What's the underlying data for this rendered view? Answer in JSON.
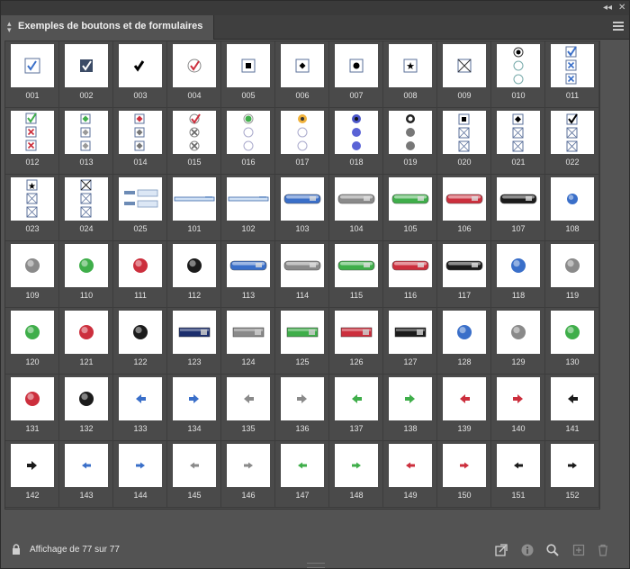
{
  "panel": {
    "title": "Exemples de boutons et de formulaires",
    "status": "Affichage de 77 sur 77"
  },
  "items": [
    {
      "label": "001",
      "kind": "check-box"
    },
    {
      "label": "002",
      "kind": "check-dark"
    },
    {
      "label": "003",
      "kind": "check-plain"
    },
    {
      "label": "004",
      "kind": "check-red-circle"
    },
    {
      "label": "005",
      "kind": "square-box"
    },
    {
      "label": "006",
      "kind": "diamond-box"
    },
    {
      "label": "007",
      "kind": "circle-box"
    },
    {
      "label": "008",
      "kind": "star-box"
    },
    {
      "label": "009",
      "kind": "cross-box"
    },
    {
      "label": "010",
      "kind": "radio-stack"
    },
    {
      "label": "011",
      "kind": "check-x-stack"
    },
    {
      "label": "012",
      "kind": "check-x-stack-red"
    },
    {
      "label": "013",
      "kind": "diamond-stack-green"
    },
    {
      "label": "014",
      "kind": "diamond-stack-red"
    },
    {
      "label": "015",
      "kind": "check-circle-stack"
    },
    {
      "label": "016",
      "kind": "radio-green-stack"
    },
    {
      "label": "017",
      "kind": "radio-orange-stack"
    },
    {
      "label": "018",
      "kind": "radio-blue-stack"
    },
    {
      "label": "019",
      "kind": "radio-gray-stack"
    },
    {
      "label": "020",
      "kind": "square-stack"
    },
    {
      "label": "021",
      "kind": "diamond-stack"
    },
    {
      "label": "022",
      "kind": "check-stack"
    },
    {
      "label": "023",
      "kind": "star-stack"
    },
    {
      "label": "024",
      "kind": "cross-stack"
    },
    {
      "label": "025",
      "kind": "fields"
    },
    {
      "label": "101",
      "kind": "bar-thin"
    },
    {
      "label": "102",
      "kind": "bar-thin"
    },
    {
      "label": "103",
      "kind": "pill-blue"
    },
    {
      "label": "104",
      "kind": "pill-gray"
    },
    {
      "label": "105",
      "kind": "pill-green"
    },
    {
      "label": "106",
      "kind": "pill-red"
    },
    {
      "label": "107",
      "kind": "pill-black"
    },
    {
      "label": "108",
      "kind": "ball-blue-sm"
    },
    {
      "label": "109",
      "kind": "ball-gray"
    },
    {
      "label": "110",
      "kind": "ball-green"
    },
    {
      "label": "111",
      "kind": "ball-red"
    },
    {
      "label": "112",
      "kind": "ball-black"
    },
    {
      "label": "113",
      "kind": "pill-blue"
    },
    {
      "label": "114",
      "kind": "pill-gray"
    },
    {
      "label": "115",
      "kind": "pill-green"
    },
    {
      "label": "116",
      "kind": "pill-red"
    },
    {
      "label": "117",
      "kind": "pill-black"
    },
    {
      "label": "118",
      "kind": "ball-blue"
    },
    {
      "label": "119",
      "kind": "ball-gray"
    },
    {
      "label": "120",
      "kind": "ball-green"
    },
    {
      "label": "121",
      "kind": "ball-red"
    },
    {
      "label": "122",
      "kind": "ball-black"
    },
    {
      "label": "123",
      "kind": "rect-navy"
    },
    {
      "label": "124",
      "kind": "rect-gray"
    },
    {
      "label": "125",
      "kind": "rect-green"
    },
    {
      "label": "126",
      "kind": "rect-red"
    },
    {
      "label": "127",
      "kind": "rect-black"
    },
    {
      "label": "128",
      "kind": "ball-blue"
    },
    {
      "label": "129",
      "kind": "ball-gray"
    },
    {
      "label": "130",
      "kind": "ball-green"
    },
    {
      "label": "131",
      "kind": "ball-red"
    },
    {
      "label": "132",
      "kind": "ball-black"
    },
    {
      "label": "133",
      "kind": "arrow-left-blue"
    },
    {
      "label": "134",
      "kind": "arrow-right-blue"
    },
    {
      "label": "135",
      "kind": "arrow-left-gray"
    },
    {
      "label": "136",
      "kind": "arrow-right-gray"
    },
    {
      "label": "137",
      "kind": "arrow-left-green"
    },
    {
      "label": "138",
      "kind": "arrow-right-green"
    },
    {
      "label": "139",
      "kind": "arrow-left-red"
    },
    {
      "label": "140",
      "kind": "arrow-right-red"
    },
    {
      "label": "141",
      "kind": "arrow-left-black"
    },
    {
      "label": "142",
      "kind": "arrow-right-black"
    },
    {
      "label": "143",
      "kind": "chevron-left-blue"
    },
    {
      "label": "144",
      "kind": "chevron-right-blue"
    },
    {
      "label": "145",
      "kind": "chevron-left-gray"
    },
    {
      "label": "146",
      "kind": "chevron-right-gray"
    },
    {
      "label": "147",
      "kind": "chevron-left-green"
    },
    {
      "label": "148",
      "kind": "chevron-right-green"
    },
    {
      "label": "149",
      "kind": "chevron-left-red"
    },
    {
      "label": "150",
      "kind": "chevron-right-red"
    },
    {
      "label": "151",
      "kind": "chevron-left-black"
    },
    {
      "label": "152",
      "kind": "chevron-right-black"
    }
  ],
  "colors": {
    "blue": "#3a6fc9",
    "gray": "#8a8a8a",
    "green": "#3fae4a",
    "red": "#cc2f3d",
    "black": "#1b1b1b",
    "navy": "#1d2f6e"
  },
  "footer_icons": [
    "lock-icon",
    "place-icon",
    "info-icon",
    "search-icon",
    "new-icon",
    "trash-icon"
  ]
}
